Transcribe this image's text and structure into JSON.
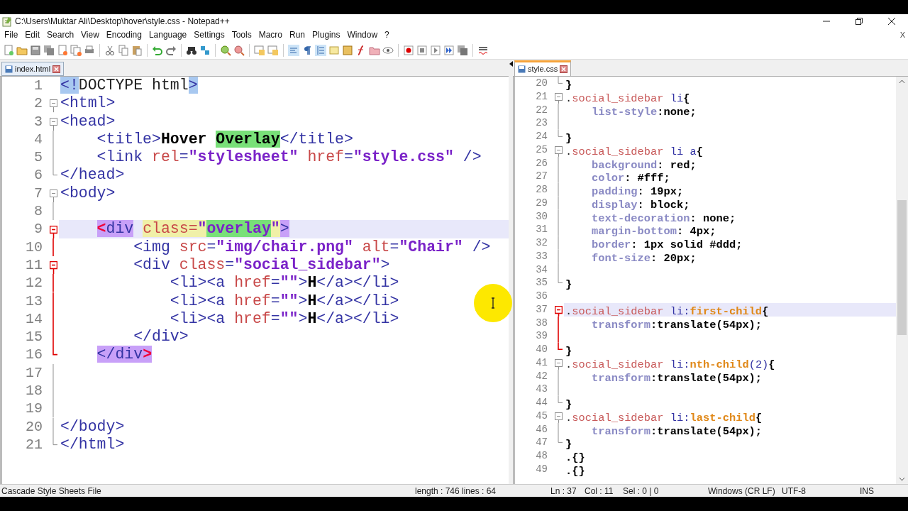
{
  "title_bar": {
    "title": "C:\\Users\\Muktar Ali\\Desktop\\hover\\style.css - Notepad++"
  },
  "menu": [
    "File",
    "Edit",
    "Search",
    "View",
    "Encoding",
    "Language",
    "Settings",
    "Tools",
    "Macro",
    "Run",
    "Plugins",
    "Window",
    "?"
  ],
  "menu_close": "X",
  "left_pane": {
    "tab": {
      "label": "index.html",
      "selected": false
    },
    "lines": [
      {
        "number": "1",
        "kind": "plain",
        "current": false,
        "tokens": [
          {
            "kind": "tag",
            "text": "<!",
            "color": "#a8c8f0"
          },
          {
            "kind": "plain",
            "text": "DOCTYPE html"
          },
          {
            "kind": "tag",
            "text": ">",
            "color": "#a8c8f0"
          }
        ]
      },
      {
        "number": "2",
        "kind": "start",
        "active": false,
        "current": false,
        "tokens": [
          {
            "kind": "tag",
            "text": "<html>"
          }
        ]
      },
      {
        "number": "3",
        "kind": "start",
        "active": false,
        "current": false,
        "tokens": [
          {
            "kind": "tag",
            "text": "<head>"
          }
        ]
      },
      {
        "number": "4",
        "kind": "mid",
        "active": false,
        "current": false,
        "tokens": [
          {
            "kind": "tag",
            "text": "    <title>"
          },
          {
            "kind": "text",
            "text": "Hover "
          },
          {
            "kind": "text",
            "text": "Overlay",
            "color": "#78e078"
          },
          {
            "kind": "tag",
            "text": "</title>"
          }
        ]
      },
      {
        "number": "5",
        "kind": "mid",
        "active": false,
        "current": false,
        "tokens": [
          {
            "kind": "tag",
            "text": "    <link "
          },
          {
            "kind": "attr",
            "text": "rel"
          },
          {
            "kind": "tag",
            "text": "="
          },
          {
            "kind": "str",
            "text": "\"stylesheet\""
          },
          {
            "kind": "attr",
            "text": " href"
          },
          {
            "kind": "tag",
            "text": "="
          },
          {
            "kind": "str",
            "text": "\"style.css\""
          },
          {
            "kind": "tag",
            "text": " />"
          }
        ]
      },
      {
        "number": "6",
        "kind": "end",
        "active": false,
        "current": false,
        "tokens": [
          {
            "kind": "tag",
            "text": "</head>"
          }
        ]
      },
      {
        "number": "7",
        "kind": "start",
        "active": false,
        "current": false,
        "tokens": [
          {
            "kind": "tag",
            "text": "<body>"
          }
        ]
      },
      {
        "number": "8",
        "kind": "mid",
        "active": false,
        "current": false
      },
      {
        "number": "9",
        "kind": "start",
        "active": true,
        "current": true,
        "tokens": [
          {
            "kind": "red",
            "text": "    <",
            "color": "#c8a0f8"
          },
          {
            "kind": "tag",
            "text": "div",
            "color": "#c8a0f8"
          },
          {
            "kind": "attr",
            "text": " class=",
            "color": "#f0f0a8"
          },
          {
            "kind": "str",
            "text": "\"",
            "color": "#f0f0a8"
          },
          {
            "kind": "str",
            "text": "overlay",
            "color": "#78e078"
          },
          {
            "kind": "str",
            "text": "\"",
            "color": "#f0f0a8"
          },
          {
            "kind": "tag",
            "text": ">",
            "color": "#c8a0f8"
          }
        ]
      },
      {
        "number": "10",
        "kind": "mid",
        "active": true,
        "current": false,
        "tokens": [
          {
            "kind": "tag",
            "text": "        <img "
          },
          {
            "kind": "attr",
            "text": "src"
          },
          {
            "kind": "tag",
            "text": "="
          },
          {
            "kind": "str",
            "text": "\"img/chair.png\""
          },
          {
            "kind": "attr",
            "text": " alt"
          },
          {
            "kind": "tag",
            "text": "="
          },
          {
            "kind": "str",
            "text": "\"Chair\""
          },
          {
            "kind": "tag",
            "text": " />"
          }
        ]
      },
      {
        "number": "11",
        "kind": "start",
        "active": true,
        "current": false,
        "tokens": [
          {
            "kind": "tag",
            "text": "        <div "
          },
          {
            "kind": "attr",
            "text": "class"
          },
          {
            "kind": "tag",
            "text": "="
          },
          {
            "kind": "str",
            "text": "\"social_sidebar\""
          },
          {
            "kind": "tag",
            "text": ">"
          }
        ]
      },
      {
        "number": "12",
        "kind": "mid",
        "active": true,
        "current": false,
        "tokens": [
          {
            "kind": "tag",
            "text": "            <li><a "
          },
          {
            "kind": "attr",
            "text": "href"
          },
          {
            "kind": "tag",
            "text": "="
          },
          {
            "kind": "str",
            "text": "\"\""
          },
          {
            "kind": "tag",
            "text": ">"
          },
          {
            "kind": "text",
            "text": "H"
          },
          {
            "kind": "tag",
            "text": "</a></li>"
          }
        ]
      },
      {
        "number": "13",
        "kind": "mid",
        "active": true,
        "current": false,
        "tokens": [
          {
            "kind": "tag",
            "text": "            <li><a "
          },
          {
            "kind": "attr",
            "text": "href"
          },
          {
            "kind": "tag",
            "text": "="
          },
          {
            "kind": "str",
            "text": "\"\""
          },
          {
            "kind": "tag",
            "text": ">"
          },
          {
            "kind": "text",
            "text": "H"
          },
          {
            "kind": "tag",
            "text": "</a></li>"
          }
        ]
      },
      {
        "number": "14",
        "kind": "mid",
        "active": true,
        "current": false,
        "tokens": [
          {
            "kind": "tag",
            "text": "            <li><a "
          },
          {
            "kind": "attr",
            "text": "href"
          },
          {
            "kind": "tag",
            "text": "="
          },
          {
            "kind": "str",
            "text": "\"\""
          },
          {
            "kind": "tag",
            "text": ">"
          },
          {
            "kind": "text",
            "text": "H"
          },
          {
            "kind": "tag",
            "text": "</a></li>"
          }
        ]
      },
      {
        "number": "15",
        "kind": "mid",
        "active": true,
        "current": false,
        "tokens": [
          {
            "kind": "tag",
            "text": "        </div>"
          }
        ]
      },
      {
        "number": "16",
        "kind": "end",
        "active": true,
        "current": false,
        "tokens": [
          {
            "kind": "tag",
            "text": "    </div",
            "color": "#c8a0f8"
          },
          {
            "kind": "red",
            "text": ">",
            "color": "#c8a0f8"
          }
        ]
      },
      {
        "number": "17",
        "kind": "mid",
        "active": false,
        "current": false
      },
      {
        "number": "18",
        "kind": "mid",
        "active": false,
        "current": false
      },
      {
        "number": "19",
        "kind": "mid",
        "active": false,
        "current": false
      },
      {
        "number": "20",
        "kind": "mid",
        "active": false,
        "current": false,
        "tokens": [
          {
            "kind": "tag",
            "text": "</body>"
          }
        ]
      },
      {
        "number": "21",
        "kind": "end",
        "active": false,
        "current": false,
        "tokens": [
          {
            "kind": "tag",
            "text": "</html>"
          }
        ]
      }
    ]
  },
  "right_pane": {
    "tab": {
      "label": "style.css",
      "selected": true
    },
    "lines": [
      {
        "number": "20",
        "kind": "end",
        "active": false,
        "current": false,
        "tokens": [
          {
            "kind": "punct",
            "text": "}"
          }
        ]
      },
      {
        "number": "21",
        "kind": "start",
        "active": false,
        "current": false,
        "tokens": [
          {
            "kind": "plain",
            "text": "."
          },
          {
            "kind": "sel",
            "text": "social_sidebar"
          },
          {
            "kind": "el",
            "text": " li"
          },
          {
            "kind": "punct",
            "text": "{"
          }
        ]
      },
      {
        "number": "22",
        "kind": "mid",
        "active": false,
        "current": false,
        "tokens": [
          {
            "kind": "prop",
            "text": "    list-style"
          },
          {
            "kind": "punct",
            "text": ":none;"
          }
        ]
      },
      {
        "number": "23",
        "kind": "mid",
        "active": false,
        "current": false
      },
      {
        "number": "24",
        "kind": "end",
        "active": false,
        "current": false,
        "tokens": [
          {
            "kind": "punct",
            "text": "}"
          }
        ]
      },
      {
        "number": "25",
        "kind": "start",
        "active": false,
        "current": false,
        "tokens": [
          {
            "kind": "plain",
            "text": "."
          },
          {
            "kind": "sel",
            "text": "social_sidebar"
          },
          {
            "kind": "el",
            "text": " li a"
          },
          {
            "kind": "punct",
            "text": "{"
          }
        ]
      },
      {
        "number": "26",
        "kind": "mid",
        "active": false,
        "current": false,
        "tokens": [
          {
            "kind": "prop",
            "text": "    background"
          },
          {
            "kind": "punct",
            "text": ": red;"
          }
        ]
      },
      {
        "number": "27",
        "kind": "mid",
        "active": false,
        "current": false,
        "tokens": [
          {
            "kind": "prop",
            "text": "    color"
          },
          {
            "kind": "punct",
            "text": ": #fff;"
          }
        ]
      },
      {
        "number": "28",
        "kind": "mid",
        "active": false,
        "current": false,
        "tokens": [
          {
            "kind": "prop",
            "text": "    padding"
          },
          {
            "kind": "punct",
            "text": ": 19px;"
          }
        ]
      },
      {
        "number": "29",
        "kind": "mid",
        "active": false,
        "current": false,
        "tokens": [
          {
            "kind": "prop",
            "text": "    display"
          },
          {
            "kind": "punct",
            "text": ": block;"
          }
        ]
      },
      {
        "number": "30",
        "kind": "mid",
        "active": false,
        "current": false,
        "tokens": [
          {
            "kind": "prop",
            "text": "    text-decoration"
          },
          {
            "kind": "punct",
            "text": ": none;"
          }
        ]
      },
      {
        "number": "31",
        "kind": "mid",
        "active": false,
        "current": false,
        "tokens": [
          {
            "kind": "prop",
            "text": "    margin-bottom"
          },
          {
            "kind": "punct",
            "text": ": 4px;"
          }
        ]
      },
      {
        "number": "32",
        "kind": "mid",
        "active": false,
        "current": false,
        "tokens": [
          {
            "kind": "prop",
            "text": "    border"
          },
          {
            "kind": "punct",
            "text": ": 1px solid #ddd;"
          }
        ]
      },
      {
        "number": "33",
        "kind": "mid",
        "active": false,
        "current": false,
        "tokens": [
          {
            "kind": "prop",
            "text": "    font-size"
          },
          {
            "kind": "punct",
            "text": ": 20px;"
          }
        ]
      },
      {
        "number": "34",
        "kind": "mid",
        "active": false,
        "current": false
      },
      {
        "number": "35",
        "kind": "end",
        "active": false,
        "current": false,
        "tokens": [
          {
            "kind": "punct",
            "text": "}"
          }
        ]
      },
      {
        "number": "36",
        "kind": "plain",
        "current": false
      },
      {
        "number": "37",
        "kind": "start",
        "active": true,
        "current": true,
        "tokens": [
          {
            "kind": "plain",
            "text": "."
          },
          {
            "kind": "sel",
            "text": "social_sidebar"
          },
          {
            "kind": "el",
            "text": " li:"
          },
          {
            "kind": "pseudo",
            "text": "first-child"
          },
          {
            "kind": "punct",
            "text": "{"
          }
        ]
      },
      {
        "number": "38",
        "kind": "mid",
        "active": true,
        "current": false,
        "tokens": [
          {
            "kind": "prop",
            "text": "    transform"
          },
          {
            "kind": "punct",
            "text": ":translate(54px);"
          }
        ]
      },
      {
        "number": "39",
        "kind": "mid",
        "active": true,
        "current": false
      },
      {
        "number": "40",
        "kind": "end",
        "active": true,
        "current": false,
        "tokens": [
          {
            "kind": "punct",
            "text": "}"
          }
        ]
      },
      {
        "number": "41",
        "kind": "start",
        "active": false,
        "current": false,
        "tokens": [
          {
            "kind": "plain",
            "text": "."
          },
          {
            "kind": "sel",
            "text": "social_sidebar"
          },
          {
            "kind": "el",
            "text": " li:"
          },
          {
            "kind": "pseudo",
            "text": "nth-child"
          },
          {
            "kind": "el",
            "text": "(2)"
          },
          {
            "kind": "punct",
            "text": "{"
          }
        ]
      },
      {
        "number": "42",
        "kind": "mid",
        "active": false,
        "current": false,
        "tokens": [
          {
            "kind": "prop",
            "text": "    transform"
          },
          {
            "kind": "punct",
            "text": ":translate(54px);"
          }
        ]
      },
      {
        "number": "43",
        "kind": "mid",
        "active": false,
        "current": false
      },
      {
        "number": "44",
        "kind": "end",
        "active": false,
        "current": false,
        "tokens": [
          {
            "kind": "punct",
            "text": "}"
          }
        ]
      },
      {
        "number": "45",
        "kind": "start",
        "active": false,
        "current": false,
        "tokens": [
          {
            "kind": "plain",
            "text": "."
          },
          {
            "kind": "sel",
            "text": "social_sidebar"
          },
          {
            "kind": "el",
            "text": " li:"
          },
          {
            "kind": "pseudo",
            "text": "last-child"
          },
          {
            "kind": "punct",
            "text": "{"
          }
        ]
      },
      {
        "number": "46",
        "kind": "mid",
        "active": false,
        "current": false,
        "tokens": [
          {
            "kind": "prop",
            "text": "    transform"
          },
          {
            "kind": "punct",
            "text": ":translate(54px);"
          }
        ]
      },
      {
        "number": "47",
        "kind": "end",
        "active": false,
        "current": false,
        "tokens": [
          {
            "kind": "punct",
            "text": "}"
          }
        ]
      },
      {
        "number": "48",
        "kind": "plain",
        "current": false,
        "tokens": [
          {
            "kind": "punct",
            "text": ".{}"
          }
        ]
      },
      {
        "number": "49",
        "kind": "plain",
        "current": false,
        "tokens": [
          {
            "kind": "punct",
            "text": ".{}"
          }
        ]
      }
    ]
  },
  "status_bar": {
    "file_type": "Cascade Style Sheets File",
    "length": "length : 746",
    "lines": "lines : 64",
    "line": "Ln : 37",
    "column": "Col : 11",
    "selection": "Sel : 0 | 0",
    "eol": "Windows (CR LF)",
    "encoding": "UTF-8",
    "mode": "INS"
  }
}
